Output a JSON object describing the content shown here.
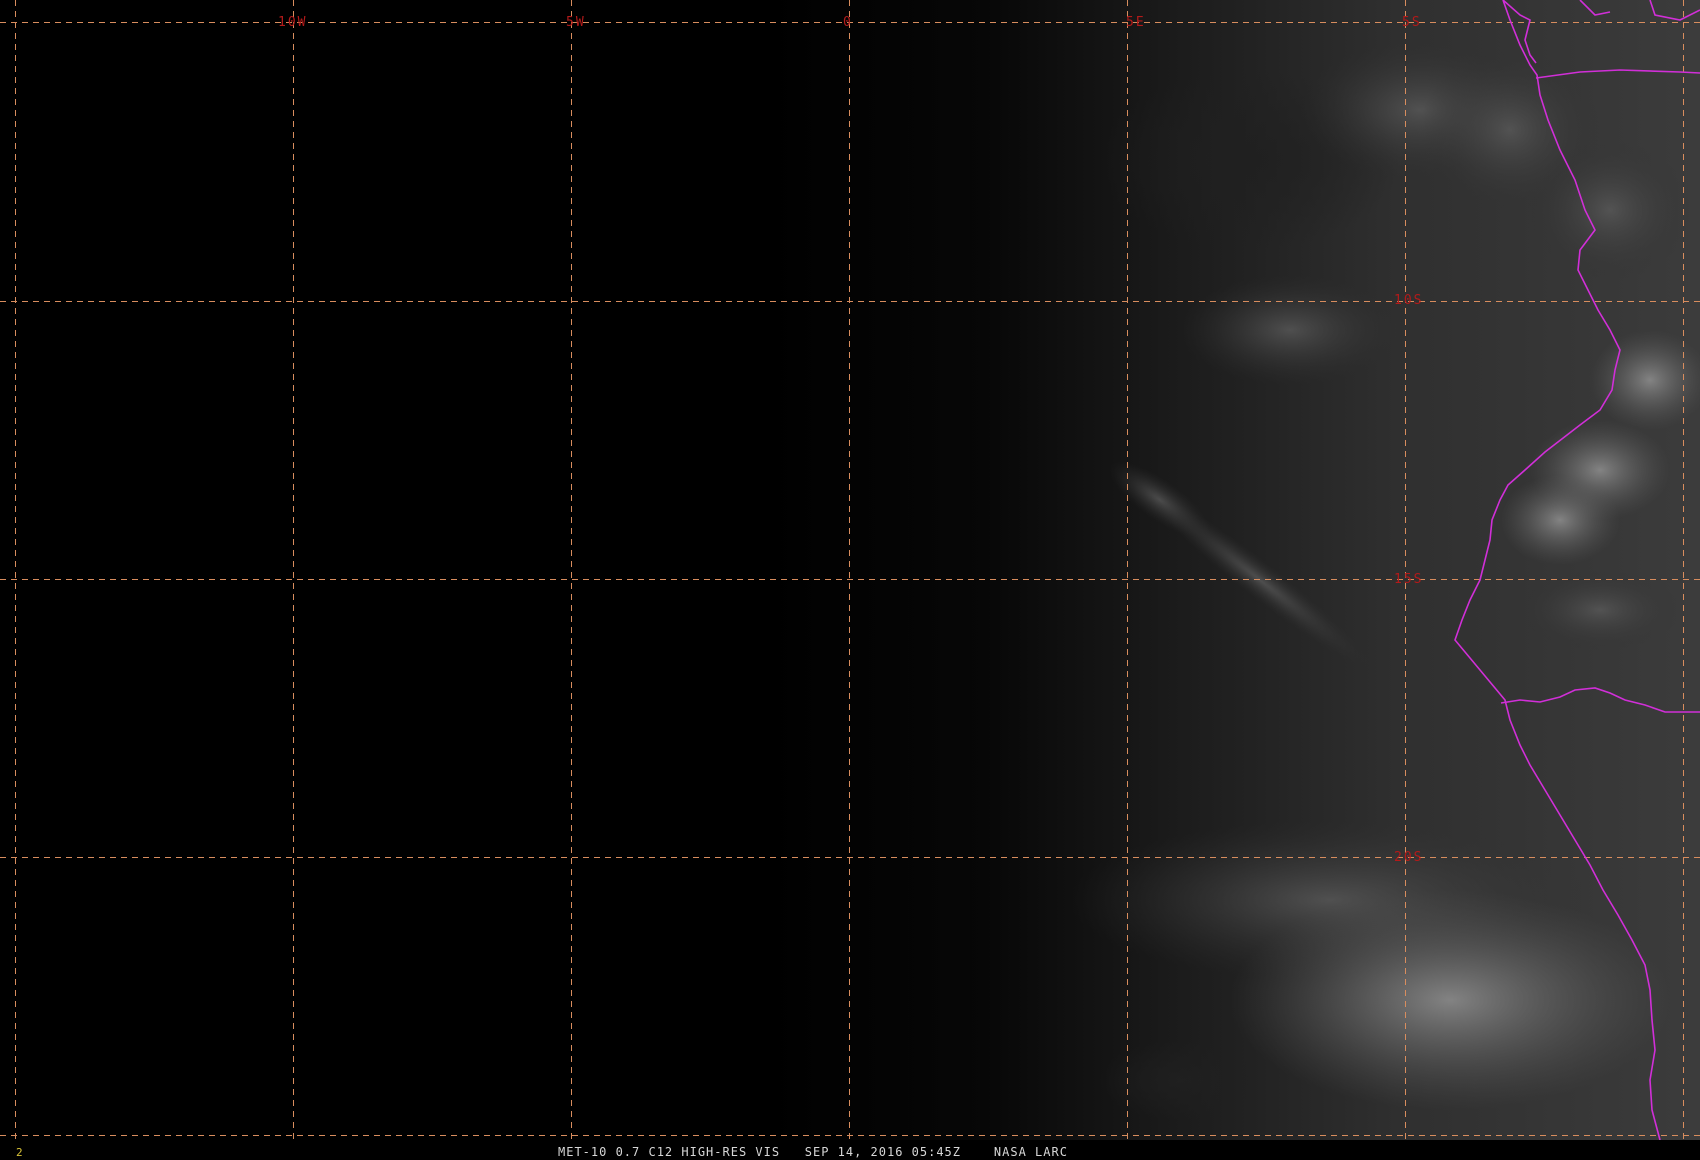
{
  "map": {
    "longitude_labels": [
      "10W",
      "5W",
      "0",
      "5E"
    ],
    "latitude_labels": [
      "5S",
      "10S",
      "15S",
      "20S"
    ],
    "colors": {
      "grid": "#d88d5e",
      "labels": "#b31a1a",
      "coastline": "#d12fd8",
      "frame_number": "#d8c338",
      "caption": "#d7d7d7"
    }
  },
  "status_bar": {
    "frame_number": "2",
    "caption": "MET-10 0.7 C12 HIGH-RES VIS   SEP 14, 2016 05:45Z    NASA LARC"
  }
}
